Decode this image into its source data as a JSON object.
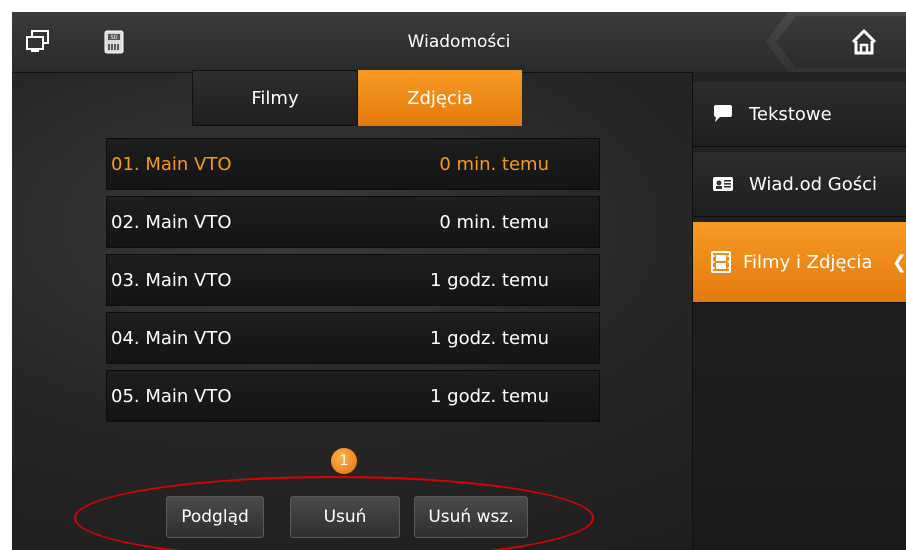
{
  "header": {
    "title": "Wiadomości",
    "left_icons": [
      "monitor-icon",
      "sd-card-icon"
    ],
    "home_icon": "home-icon"
  },
  "tabs": [
    {
      "label": "Filmy",
      "active": false
    },
    {
      "label": "Zdjęcia",
      "active": true
    }
  ],
  "messages": [
    {
      "name": "01. Main VTO",
      "time": "0 min. temu",
      "highlight": true
    },
    {
      "name": "02. Main VTO",
      "time": "0 min. temu",
      "highlight": false
    },
    {
      "name": "03. Main VTO",
      "time": "1 godz. temu",
      "highlight": false
    },
    {
      "name": "04. Main VTO",
      "time": "1 godz. temu",
      "highlight": false
    },
    {
      "name": "05. Main VTO",
      "time": "1 godz. temu",
      "highlight": false
    }
  ],
  "pagination": {
    "page": "1"
  },
  "actions": {
    "preview_label": "Podgląd",
    "delete_label": "Usuń",
    "delete_all_label": "Usuń wsz."
  },
  "sidebar": {
    "items": [
      {
        "label": "Tekstowe",
        "icon": "speech-bubble-icon",
        "active": false
      },
      {
        "label": "Wiad.od Gości",
        "icon": "guest-message-icon",
        "active": false
      },
      {
        "label": "Filmy i Zdjęcia",
        "icon": "film-icon",
        "active": true
      }
    ]
  },
  "colors": {
    "accent": "#f7991d",
    "background": "#222222",
    "annotation": "#e00000"
  }
}
